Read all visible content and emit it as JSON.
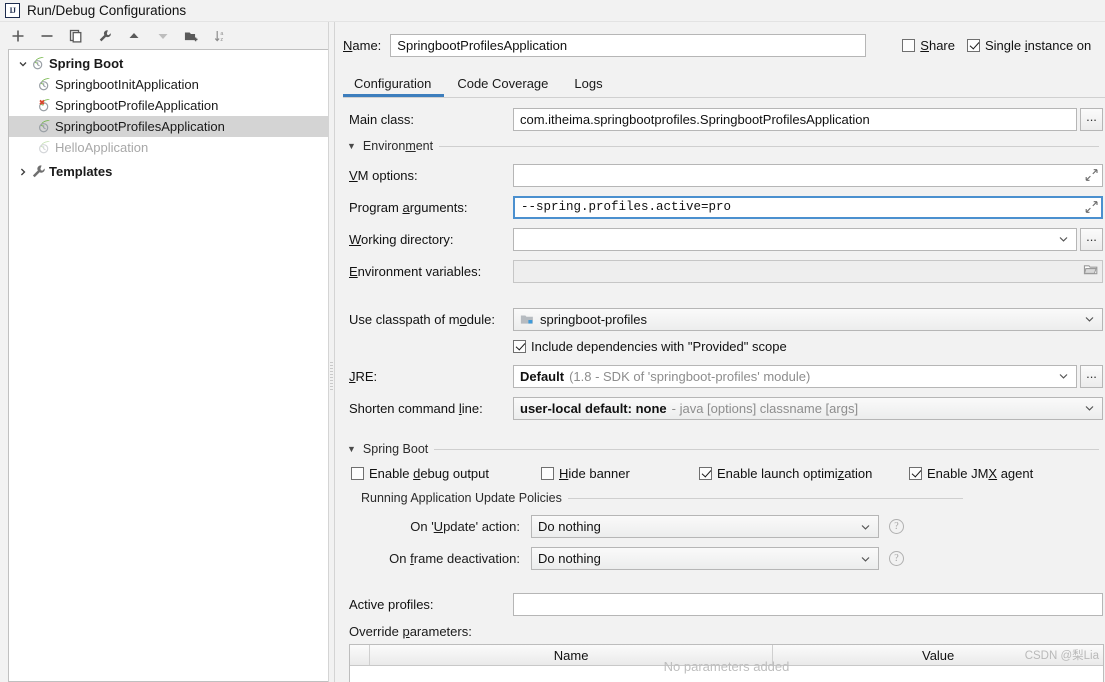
{
  "window": {
    "title": "Run/Debug Configurations",
    "app_icon": "intellij-idea-icon",
    "icon_text": "IJ"
  },
  "toolbar": {
    "buttons": [
      {
        "name": "add-configuration-button",
        "icon": "plus-icon",
        "label": "+"
      },
      {
        "name": "remove-configuration-button",
        "icon": "minus-icon",
        "label": "−"
      },
      {
        "name": "copy-configuration-button",
        "icon": "copy-icon",
        "label": "Copy"
      },
      {
        "name": "edit-templates-button",
        "icon": "wrench-icon",
        "label": "Edit Templates"
      },
      {
        "name": "move-up-button",
        "icon": "arrow-up-icon",
        "label": "Move Up"
      },
      {
        "name": "move-down-button",
        "icon": "arrow-down-icon",
        "label": "Move Down"
      },
      {
        "name": "create-folder-button",
        "icon": "folder-add-icon",
        "label": "New Folder"
      },
      {
        "name": "sort-button",
        "icon": "sort-alphabetical-icon",
        "label": "Sort"
      }
    ]
  },
  "tree": {
    "root": {
      "label": "Spring Boot",
      "icon": "spring-boot-icon",
      "expanded": true,
      "twisty": "chevron-down-icon"
    },
    "children": [
      {
        "label": "SpringbootInitApplication",
        "icon": "spring-boot-icon",
        "state": "normal"
      },
      {
        "label": "SpringbootProfileApplication",
        "icon": "spring-boot-error-icon",
        "state": "error"
      },
      {
        "label": "SpringbootProfilesApplication",
        "icon": "spring-boot-icon",
        "state": "selected"
      },
      {
        "label": "HelloApplication",
        "icon": "spring-boot-icon",
        "state": "temporary"
      }
    ],
    "templates": {
      "label": "Templates",
      "icon": "wrench-icon",
      "expanded": false,
      "twisty": "chevron-right-icon"
    }
  },
  "header": {
    "name_label": "Name:",
    "name_underline_char": "N",
    "name_value": "SpringbootProfilesApplication",
    "name_placeholder": "",
    "share": {
      "label": "Share",
      "checked": false
    },
    "single_instance": {
      "label": "Single instance on",
      "checked": true
    }
  },
  "tabs": [
    {
      "label": "Configuration",
      "active": true
    },
    {
      "label": "Code Coverage",
      "active": false
    },
    {
      "label": "Logs",
      "active": false
    }
  ],
  "form": {
    "main_class": {
      "label": "Main class:",
      "value": "com.itheima.springbootprofiles.SpringbootProfilesApplication",
      "button": "..."
    },
    "environment_group": "Environment",
    "vm_options": {
      "label": "VM options:",
      "value": "",
      "icon": "expand-icon"
    },
    "program_arguments": {
      "label": "Program arguments:",
      "value": "--spring.profiles.active=pro",
      "icon": "expand-icon",
      "focused": true
    },
    "working_directory": {
      "label": "Working directory:",
      "value": "",
      "button": "..."
    },
    "environment_variables": {
      "label": "Environment variables:",
      "value": "",
      "icon": "folder-icon"
    },
    "use_classpath_of_module": {
      "label": "Use classpath of module:",
      "value": "springboot-profiles",
      "icon": "module-icon"
    },
    "include_provided": {
      "label": "Include dependencies with \"Provided\" scope",
      "checked": true
    },
    "jre": {
      "label": "JRE:",
      "value": "Default",
      "hint": "(1.8 - SDK of 'springboot-profiles' module)",
      "button": "..."
    },
    "shorten_command_line": {
      "label": "Shorten command line:",
      "value": "user-local default: none",
      "hint": "- java [options] classname [args]"
    }
  },
  "spring_boot": {
    "group_label": "Spring Boot",
    "checkboxes": [
      {
        "label": "Enable debug output",
        "checked": false,
        "name": "enable-debug-output-checkbox"
      },
      {
        "label": "Hide banner",
        "checked": false,
        "name": "hide-banner-checkbox"
      },
      {
        "label": "Enable launch optimization",
        "checked": true,
        "name": "enable-launch-optimization-checkbox"
      },
      {
        "label": "Enable JMX agent",
        "checked": true,
        "name": "enable-jmx-agent-checkbox"
      }
    ],
    "update_policies_label": "Running Application Update Policies",
    "on_update_action": {
      "label": "On 'Update' action:",
      "value": "Do nothing",
      "help": "?"
    },
    "on_frame_deactivation": {
      "label": "On frame deactivation:",
      "value": "Do nothing",
      "help": "?"
    },
    "active_profiles": {
      "label": "Active profiles:",
      "value": "",
      "placeholder": ""
    },
    "override_parameters": {
      "label": "Override parameters:",
      "columns": [
        "Name",
        "Value"
      ],
      "rows": [],
      "empty_text": "No parameters added"
    }
  },
  "watermark": "CSDN @梨Lia",
  "colors": {
    "accent": "#3d7ebd",
    "selection": "#d4d4d4",
    "panel": "#f2f2f2",
    "field_border": "#b6b6b6",
    "focus_border": "#4b90cf",
    "spring_green": "#6db33f",
    "error_red": "#d9452c"
  }
}
